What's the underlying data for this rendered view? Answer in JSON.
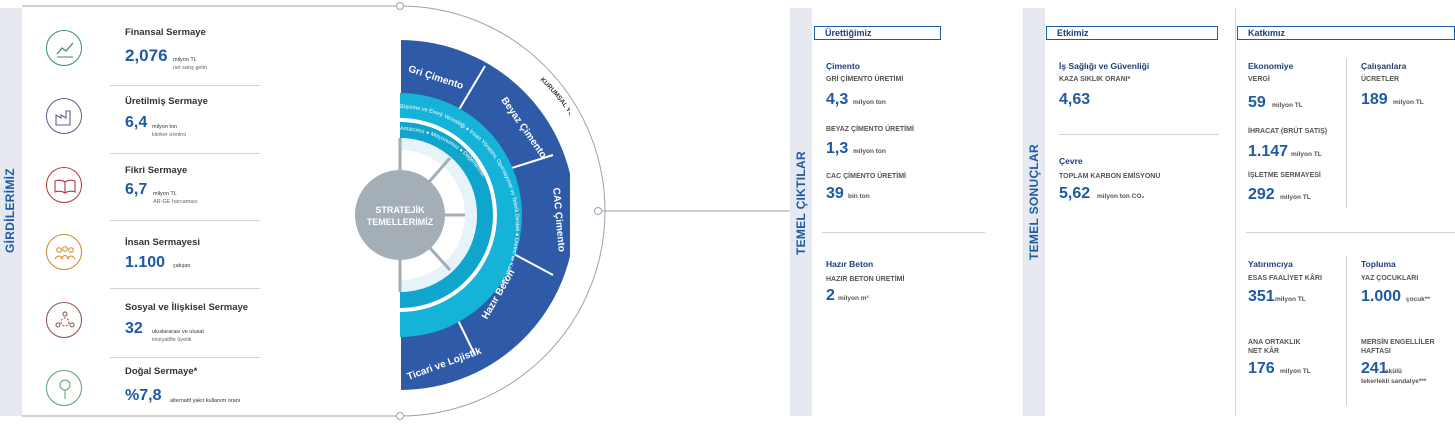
{
  "left": {
    "vertical_title": "GİRDİLERİMİZ",
    "capitals": [
      {
        "icon": "chart-trend-icon",
        "title": "Finansal Sermaye",
        "value": "2,076",
        "unit": "milyon TL",
        "sub": "net satış geliri"
      },
      {
        "icon": "factory-icon",
        "title": "Üretilmiş Sermaye",
        "value": "6,4",
        "unit": "milyon ton",
        "sub": "klinker üretimi"
      },
      {
        "icon": "open-book-icon",
        "title": "Fikri Sermaye",
        "value": "6,7",
        "unit": "milyon TL",
        "sub": "AR-GE harcaması"
      },
      {
        "icon": "people-group-icon",
        "title": "İnsan Sermayesi",
        "value": "1.100",
        "unit": "çalışan",
        "sub": ""
      },
      {
        "icon": "network-people-icon",
        "title": "Sosyal ve İlişkisel Sermaye",
        "value": "32",
        "unit": "uluslararası ve ulusal",
        "sub": "inisiyatifle üyelik"
      },
      {
        "icon": "tree-icon",
        "title": "Doğal Sermaye*",
        "value": "%7,8",
        "unit": "alternatif yakıt kullanım oranı",
        "sub": ""
      }
    ]
  },
  "diagram": {
    "center": [
      "STRATEJİK",
      "TEMELLERİMİZ"
    ],
    "outer_segments": [
      "Gri Çimento",
      "Beyaz Çimento",
      "CAC Çimento",
      "Hazır Beton",
      "Ticari ve Lojistik"
    ],
    "ring_text_outer": "Büyüme ve Enerji Verimliliği ● İnsan Yönetimi, Operasyonel ve Teknik Destek ● Üretim ve Kalite Güvenliği",
    "ring_text_inner": "Amacımız ● Misyonumuz ● Değerlerimiz",
    "arc_label": "KURUMSAL YÖNETİM ● RİSK YÖNETİMİ",
    "colors": {
      "dark_blue": "#2e5aa8",
      "cyan": "#16b3d8",
      "light_cyan": "#bfe6f3",
      "grey": "#a4aeb6"
    }
  },
  "outputs": {
    "vertical_title": "TEMEL ÇIKTILAR",
    "header": "Ürettiğimiz",
    "cimento_title": "Çimento",
    "items": [
      {
        "label": "GRİ ÇİMENTO ÜRETİMİ",
        "value": "4,3",
        "unit": "milyon ton"
      },
      {
        "label": "BEYAZ ÇİMENTO ÜRETİMİ",
        "value": "1,3",
        "unit": "milyon ton"
      },
      {
        "label": "CAC ÇİMENTO ÜRETİMİ",
        "value": "39",
        "unit": "bin ton"
      }
    ],
    "beton_title": "Hazır Beton",
    "beton": {
      "label": "HAZIR BETON ÜRETİMİ",
      "value": "2",
      "unit": "milyon m³"
    }
  },
  "results": {
    "vertical_title": "TEMEL SONUÇLAR",
    "header": "Etkimiz",
    "isg_title": "İş Sağlığı ve Güvenliği",
    "isg_label": "KAZA SIKLIK ORANI*",
    "isg_value": "4,63",
    "cevre_title": "Çevre",
    "cevre_label": "TOPLAM KARBON EMİSYONU",
    "cevre_value": "5,62",
    "cevre_unit": "milyon ton CO₂"
  },
  "contribution": {
    "header": "Katkımız",
    "ekonomiye": "Ekonomiye",
    "vergi_label": "VERGİ",
    "vergi_value": "59",
    "vergi_unit": "milyon TL",
    "ihracat_label": "İHRACAT (BRÜT SATIŞ)",
    "ihracat_value": "1.147",
    "ihracat_unit": "milyon TL",
    "isletme_label": "İŞLETME SERMAYESİ",
    "isletme_value": "292",
    "isletme_unit": "milyon TL",
    "calisanlara": "Çalışanlara",
    "ucret_label": "ÜCRETLER",
    "ucret_value": "189",
    "ucret_unit": "milyon TL",
    "yatirimciya": "Yatırımcıya",
    "faaliyet_label": "ESAS FAALİYET KÂRI",
    "faaliyet_value": "351",
    "faaliyet_unit": "milyon TL",
    "netkar_label1": "ANA ORTAKLIK",
    "netkar_label2": "NET KÂR",
    "netkar_value": "176",
    "netkar_unit": "milyon TL",
    "topluma": "Topluma",
    "yaz_label": "YAZ ÇOCUKLARI",
    "yaz_value": "1.000",
    "yaz_unit": "çocuk**",
    "mersin_label1": "MERSİN ENGELLİLER",
    "mersin_label2": "HAFTASI",
    "mersin_value": "241",
    "mersin_unit1": "akülü",
    "mersin_unit2": "tekerlekli sandalye***"
  }
}
